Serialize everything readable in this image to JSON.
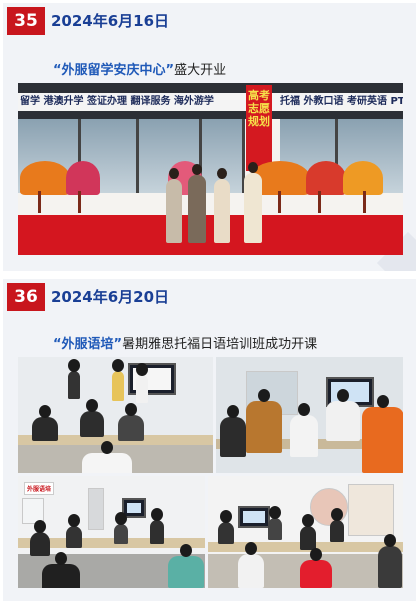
{
  "entries": [
    {
      "number": "35",
      "date": "2024年6月16日",
      "caption_quoted": "“外服留学安庆中心”",
      "caption_rest": "盛大开业",
      "photo_icon": "storefront-opening-photo",
      "sign_text": "留学 港澳升学 签证办理 翻译服务 海外游学",
      "sign_text_right": "托福 外教口语 考研英语 PT",
      "banner_text": "高考志愿规划"
    },
    {
      "number": "36",
      "date": "2024年6月20日",
      "caption_quoted": "“外服语培”",
      "caption_rest": "暑期雅思托福日语培训班成功开课",
      "photo_icons": [
        "classroom-photo-1",
        "classroom-photo-2",
        "classroom-photo-3",
        "classroom-photo-4"
      ],
      "logo_text": "外服语培"
    }
  ],
  "colors": {
    "accent_red": "#c8161d",
    "date_blue": "#1a3f95",
    "quote_blue": "#1f59b8",
    "panel_bg": "#f1f3f7"
  }
}
